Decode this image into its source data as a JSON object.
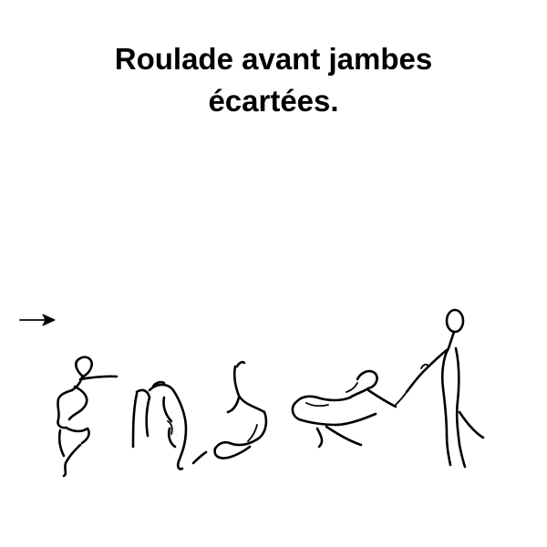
{
  "title": {
    "line1": "Roulade avant jambes",
    "line2": "écartées."
  },
  "direction": "right-arrow-icon",
  "figures": [
    "figure-crouch",
    "figure-hands-down",
    "figure-rolling",
    "figure-legs-apart",
    "figure-standing"
  ]
}
